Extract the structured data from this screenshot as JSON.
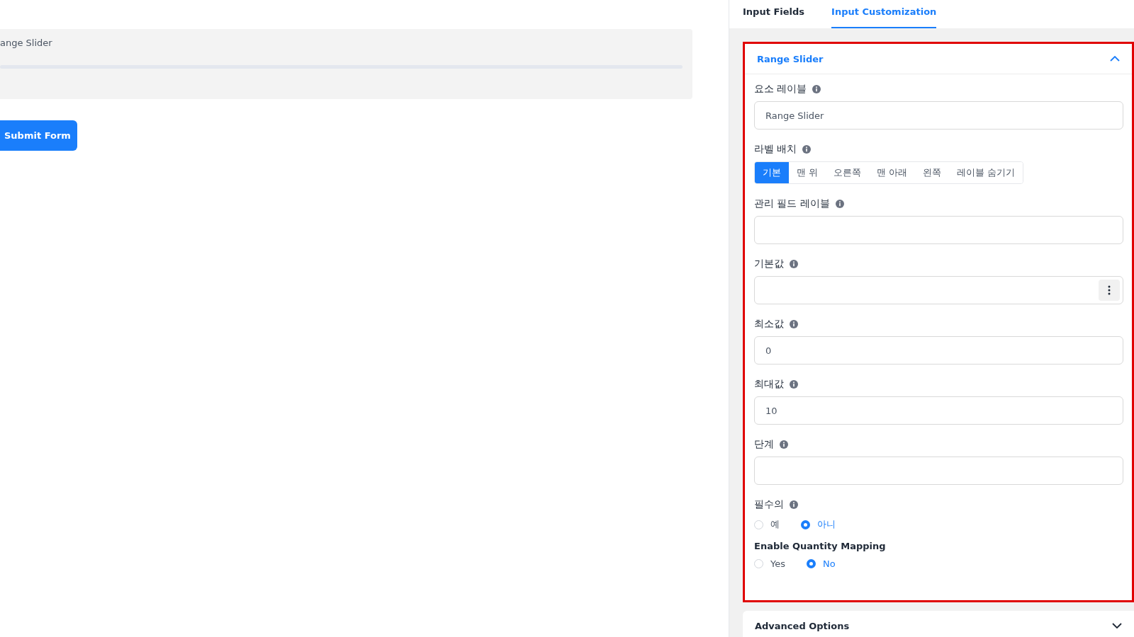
{
  "preview": {
    "label": "ange Slider",
    "submit": "Submit Form"
  },
  "tabs": [
    {
      "label": "Input Fields",
      "selected": false
    },
    {
      "label": "Input Customization",
      "selected": true
    }
  ],
  "section": {
    "title": "Range Slider",
    "expanded": true,
    "fields": [
      {
        "kind": "text",
        "label": "요소 레이블",
        "info": true,
        "value": "Range Slider"
      },
      {
        "kind": "segmented",
        "label": "라벨 배치",
        "info": true,
        "options": [
          {
            "label": "기본",
            "selected": true
          },
          {
            "label": "맨 위",
            "selected": false
          },
          {
            "label": "오른쪽",
            "selected": false
          },
          {
            "label": "맨 아래",
            "selected": false
          },
          {
            "label": "왼쪽",
            "selected": false
          },
          {
            "label": "레이블 숨기기",
            "selected": false
          }
        ]
      },
      {
        "kind": "text",
        "label": "관리 필드 레이블",
        "info": true
      },
      {
        "kind": "menu-text",
        "label": "기본값",
        "info": true
      },
      {
        "kind": "text",
        "label": "최소값",
        "info": true,
        "value": "0"
      },
      {
        "kind": "text",
        "label": "최대값",
        "info": true,
        "value": "10"
      },
      {
        "kind": "text",
        "label": "단계",
        "info": true
      },
      {
        "kind": "radio",
        "label": "필수의",
        "info": true,
        "options": [
          {
            "label": "예",
            "selected": false
          },
          {
            "label": "아니",
            "selected": true
          }
        ]
      },
      {
        "kind": "radio",
        "label": "Enable Quantity Mapping",
        "info": false,
        "options": [
          {
            "label": "Yes",
            "selected": false
          },
          {
            "label": "No",
            "selected": true
          }
        ]
      }
    ]
  },
  "advanced": {
    "title": "Advanced Options",
    "expanded": false
  }
}
